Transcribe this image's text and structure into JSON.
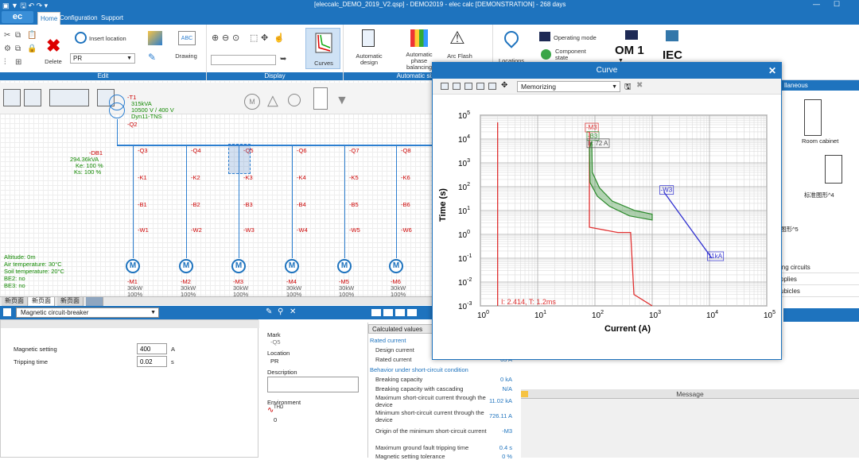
{
  "window": {
    "title": "[eleccalc_DEMO_2019_V2.qsp] - DEMO2019 - elec calc [DEMONSTRATION] - 268 days"
  },
  "app": {
    "logo": "ec"
  },
  "tabs": [
    "Home",
    "Configuration",
    "Support"
  ],
  "ribbon": {
    "edit": {
      "label": "Edit",
      "delete": "Delete",
      "insert_location": "Insert location",
      "location_value": "PR",
      "drawing": "Drawing"
    },
    "display": {
      "label": "Display",
      "curves": "Curves"
    },
    "sizing": {
      "label": "Automatic sizin",
      "automatic_design": "Automatic design",
      "phase_balancing": "Automatic phase balancing",
      "arc_flash": "Arc Flash"
    },
    "locations": "Locations",
    "operating_mode": "Operating mode",
    "component_state": "Component state",
    "om": "OM 1",
    "iec": "IEC"
  },
  "schematic": {
    "transformer": {
      "name": "-T1",
      "power": "315kVA",
      "voltage": "10500 V / 400 V",
      "coupling": "Dyn11-TNS",
      "breaker": "-Q2"
    },
    "busbar": {
      "name": "-DB1",
      "power": "294.36kVA",
      "ke": "Ke: 100 %",
      "ks": "Ks: 100 %"
    },
    "environment": [
      "Altitude: 0m",
      "Air temperature: 30°C",
      "Soil temperature: 20°C",
      "BE2: no",
      "BE3: no"
    ],
    "feeders": [
      {
        "q": "-Q3",
        "k": "-K1",
        "b": "-B1",
        "w": "-W1",
        "m": "-M1",
        "p": "30kW",
        "pct": "100%"
      },
      {
        "q": "-Q4",
        "k": "-K2",
        "b": "-B2",
        "w": "-W2",
        "m": "-M2",
        "p": "30kW",
        "pct": "100%"
      },
      {
        "q": "-Q5",
        "k": "-K3",
        "b": "-B3",
        "w": "-W3",
        "m": "-M3",
        "p": "30kW",
        "pct": "100%"
      },
      {
        "q": "-Q6",
        "k": "-K4",
        "b": "-B4",
        "w": "-W4",
        "m": "-M4",
        "p": "30kW",
        "pct": "100%"
      },
      {
        "q": "-Q7",
        "k": "-K5",
        "b": "-B5",
        "w": "-W5",
        "m": "-M5",
        "p": "30kW",
        "pct": "100%"
      },
      {
        "q": "-Q8",
        "k": "-K6",
        "b": "-B6",
        "w": "-W6",
        "m": "-M6",
        "p": "30kW",
        "pct": "100%"
      }
    ],
    "motor_symbol": "M",
    "sheet_tabs": [
      "新页面",
      "新页面",
      "新页面"
    ]
  },
  "properties": {
    "component_type": "Magnetic circuit-breaker",
    "magnetic_setting_label": "Magnetic setting",
    "magnetic_setting_value": "400",
    "magnetic_setting_unit": "A",
    "tripping_time_label": "Tripping time",
    "tripping_time_value": "0.02",
    "tripping_time_unit": "s"
  },
  "identity": {
    "mark_label": "Mark",
    "mark_value": "-Q5",
    "location_label": "Location",
    "location_value": "PR",
    "description_label": "Description",
    "environment_label": "Environment",
    "thd_label": "THD",
    "thd_value": "0"
  },
  "calculated": {
    "tab": "Calculated values",
    "rated_current_head": "Rated current",
    "design_current": "Design current",
    "rated_current": "Rated current",
    "rated_current_value": "63 A",
    "short_circuit_head": "Behavior under short-circuit condition",
    "rows": [
      {
        "label": "Breaking capacity",
        "value": "0 kA"
      },
      {
        "label": "Breaking capacity with cascading",
        "value": "N/A"
      },
      {
        "label": "Maximum short-circuit current through the device",
        "value": "11.02 kA"
      },
      {
        "label": "Minimum short-circuit current through the device",
        "value": "726.11 A"
      },
      {
        "label": "Origin of the minimum short-circuit current",
        "value": "-M3"
      },
      {
        "label": "Maximum ground fault tripping time",
        "value": "0.4 s"
      },
      {
        "label": "Magnetic setting tolerance",
        "value": "0 %"
      }
    ]
  },
  "right_panel": {
    "header": "llaneous",
    "room_cabinet": "Room cabinet",
    "cubicle_label": "标准图形^4",
    "cubicle_label2": "图形^5",
    "items": [
      "ing circuits",
      "pplies",
      "ubicles"
    ]
  },
  "message_panel": {
    "header": "Message"
  },
  "curve_window": {
    "title": "Curve",
    "toolbar_select": "Memorizing",
    "cursor_readout": "I: 2.414, T: 1.2ms",
    "labels": {
      "m3": "-M3",
      "b3": "-B3",
      "b3_rating": "Ir: 72 A",
      "w3": "-W3",
      "w3_end": "11kA"
    }
  },
  "chart_data": {
    "type": "line",
    "title": "",
    "xlabel": "Current (A)",
    "ylabel": "Time (s)",
    "xscale": "log",
    "yscale": "log",
    "xlim": [
      1,
      100000
    ],
    "ylim": [
      0.001,
      100000
    ],
    "x_ticks": [
      "10^0",
      "10^1",
      "10^2",
      "10^3",
      "10^4",
      "10^5"
    ],
    "y_ticks": [
      "10^-3",
      "10^-2",
      "10^-1",
      "10^0",
      "10^1",
      "10^2",
      "10^3",
      "10^4",
      "10^5"
    ],
    "grid": true,
    "series": [
      {
        "name": "-M3",
        "color": "#e03030",
        "points": [
          [
            2,
            0.001
          ],
          [
            2,
            50000
          ]
        ]
      },
      {
        "name": "-M3",
        "color": "#e03030",
        "points": [
          [
            72,
            20000
          ],
          [
            80,
            20000
          ],
          [
            80,
            2
          ],
          [
            250,
            1.2
          ],
          [
            420,
            1.2
          ],
          [
            480,
            0.003
          ],
          [
            1000,
            0.001
          ]
        ]
      },
      {
        "name": "-B3",
        "color": "#2e8b2e",
        "band": true,
        "upper": [
          [
            88,
            8000
          ],
          [
            90,
            400
          ],
          [
            120,
            90
          ],
          [
            200,
            25
          ],
          [
            500,
            10
          ],
          [
            1000,
            7
          ]
        ],
        "lower": [
          [
            80,
            4000
          ],
          [
            82,
            150
          ],
          [
            110,
            40
          ],
          [
            180,
            15
          ],
          [
            400,
            6
          ],
          [
            1000,
            4
          ]
        ]
      },
      {
        "name": "-W3",
        "color": "#3030d0",
        "points": [
          [
            1600,
            60
          ],
          [
            11000,
            0.1
          ]
        ]
      }
    ]
  },
  "colors": {
    "accent": "#1e73be",
    "relay_red": "#c00000",
    "motor_blue": "#1e73be"
  }
}
